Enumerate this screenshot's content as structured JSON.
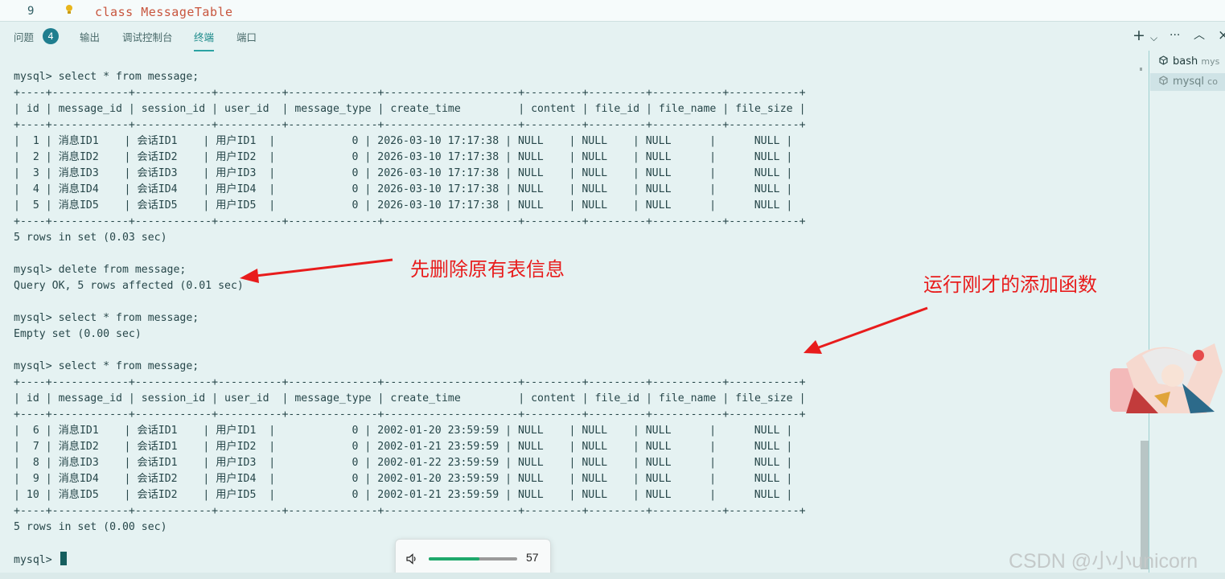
{
  "editor": {
    "line_number": "9",
    "code_keyword": "class",
    "code_name": "MessageTable"
  },
  "panel": {
    "tabs": [
      {
        "label": "问题"
      },
      {
        "label": "输出"
      },
      {
        "label": "调试控制台"
      },
      {
        "label": "终端"
      },
      {
        "label": "端口"
      }
    ],
    "problems_count": "4",
    "active_tab": "终端",
    "actions": {
      "add": "+",
      "dropdown": "⌵",
      "more": "···",
      "collapse": "︿",
      "close": "×"
    }
  },
  "terminal": {
    "lines": [
      "mysql> select * from message;",
      "+----+------------+------------+----------+--------------+---------------------+---------+---------+-----------+-----------+",
      "| id | message_id | session_id | user_id  | message_type | create_time         | content | file_id | file_name | file_size |",
      "+----+------------+------------+----------+--------------+---------------------+---------+---------+-----------+-----------+",
      "|  1 | 消息ID1    | 会话ID1    | 用户ID1  |            0 | 2026-03-10 17:17:38 | NULL    | NULL    | NULL      |      NULL |",
      "|  2 | 消息ID2    | 会话ID2    | 用户ID2  |            0 | 2026-03-10 17:17:38 | NULL    | NULL    | NULL      |      NULL |",
      "|  3 | 消息ID3    | 会话ID3    | 用户ID3  |            0 | 2026-03-10 17:17:38 | NULL    | NULL    | NULL      |      NULL |",
      "|  4 | 消息ID4    | 会话ID4    | 用户ID4  |            0 | 2026-03-10 17:17:38 | NULL    | NULL    | NULL      |      NULL |",
      "|  5 | 消息ID5    | 会话ID5    | 用户ID5  |            0 | 2026-03-10 17:17:38 | NULL    | NULL    | NULL      |      NULL |",
      "+----+------------+------------+----------+--------------+---------------------+---------+---------+-----------+-----------+",
      "5 rows in set (0.03 sec)",
      "",
      "mysql> delete from message;",
      "Query OK, 5 rows affected (0.01 sec)",
      "",
      "mysql> select * from message;",
      "Empty set (0.00 sec)",
      "",
      "mysql> select * from message;",
      "+----+------------+------------+----------+--------------+---------------------+---------+---------+-----------+-----------+",
      "| id | message_id | session_id | user_id  | message_type | create_time         | content | file_id | file_name | file_size |",
      "+----+------------+------------+----------+--------------+---------------------+---------+---------+-----------+-----------+",
      "|  6 | 消息ID1    | 会话ID1    | 用户ID1  |            0 | 2002-01-20 23:59:59 | NULL    | NULL    | NULL      |      NULL |",
      "|  7 | 消息ID2    | 会话ID1    | 用户ID2  |            0 | 2002-01-21 23:59:59 | NULL    | NULL    | NULL      |      NULL |",
      "|  8 | 消息ID3    | 会话ID1    | 用户ID3  |            0 | 2002-01-22 23:59:59 | NULL    | NULL    | NULL      |      NULL |",
      "|  9 | 消息ID4    | 会话ID2    | 用户ID4  |            0 | 2002-01-20 23:59:59 | NULL    | NULL    | NULL      |      NULL |",
      "| 10 | 消息ID5    | 会话ID2    | 用户ID5  |            0 | 2002-01-21 23:59:59 | NULL    | NULL    | NULL      |      NULL |",
      "+----+------------+------------+----------+--------------+---------------------+---------+---------+-----------+-----------+",
      "5 rows in set (0.00 sec)",
      ""
    ],
    "prompt": "mysql>"
  },
  "sidebar": {
    "items": [
      {
        "label": "bash",
        "detail": "mys"
      },
      {
        "label": "mysql",
        "detail": "co"
      }
    ]
  },
  "annotations": {
    "delete_note": "先删除原有表信息",
    "run_note": "运行刚才的添加函数",
    "color": "#e81c1c"
  },
  "volume": {
    "value": "57",
    "level": 0.57,
    "accent": "#1ea86b"
  },
  "watermark": "CSDN @小小unicorn",
  "colors": {
    "background": "#e5f2f2",
    "accent": "#2ba3a3",
    "badge": "#1f7e8f"
  }
}
